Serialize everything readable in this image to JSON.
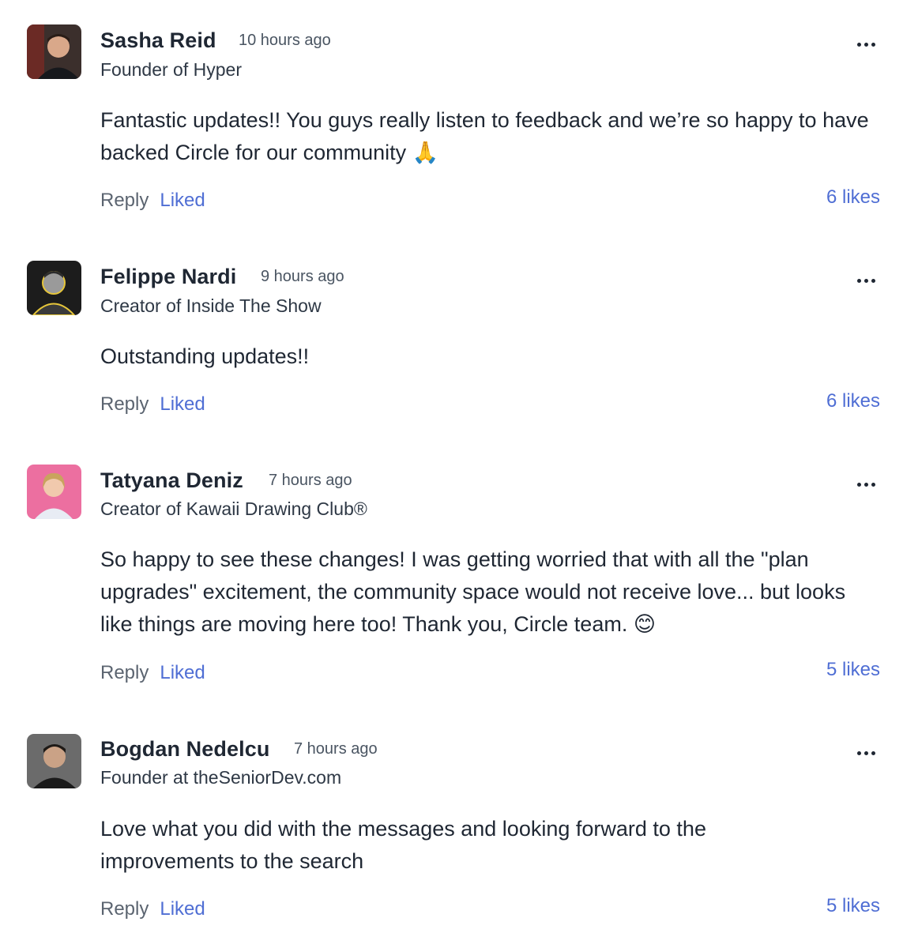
{
  "comments": [
    {
      "author": "Sasha Reid",
      "time": "10 hours ago",
      "subtitle": "Founder of Hyper",
      "body": "Fantastic updates!! You guys really listen to feedback and we’re so happy to have backed Circle for our community 🙏",
      "reply_label": "Reply",
      "liked_label": "Liked",
      "likes": "6 likes",
      "avatar_icon": "person-photo-avatar"
    },
    {
      "author": "Felippe Nardi",
      "time": "9 hours ago",
      "subtitle": "Creator of Inside The Show",
      "body": "Outstanding updates!!",
      "reply_label": "Reply",
      "liked_label": "Liked",
      "likes": "6 likes",
      "avatar_icon": "person-photo-avatar"
    },
    {
      "author": "Tatyana Deniz",
      "time": "7 hours ago",
      "subtitle": "Creator of Kawaii Drawing Club®",
      "body": "So happy to see these changes! I was getting worried that with all the \"plan upgrades\" excitement, the community space would not receive love... but looks like things are moving here too! Thank you, Circle team. 😊",
      "reply_label": "Reply",
      "liked_label": "Liked",
      "likes": "5 likes",
      "avatar_icon": "person-photo-avatar"
    },
    {
      "author": "Bogdan Nedelcu",
      "time": "7 hours ago",
      "subtitle": "Founder at theSeniorDev.com",
      "body": "Love what you did with the messages and looking forward to the improvements to the search",
      "reply_label": "Reply",
      "liked_label": "Liked",
      "likes": "5 likes",
      "avatar_icon": "person-photo-avatar"
    }
  ],
  "colors": {
    "text": "#1f2733",
    "muted": "#5b6470",
    "accent": "#4f6ed4"
  },
  "more_icon": "more-horizontal-icon"
}
